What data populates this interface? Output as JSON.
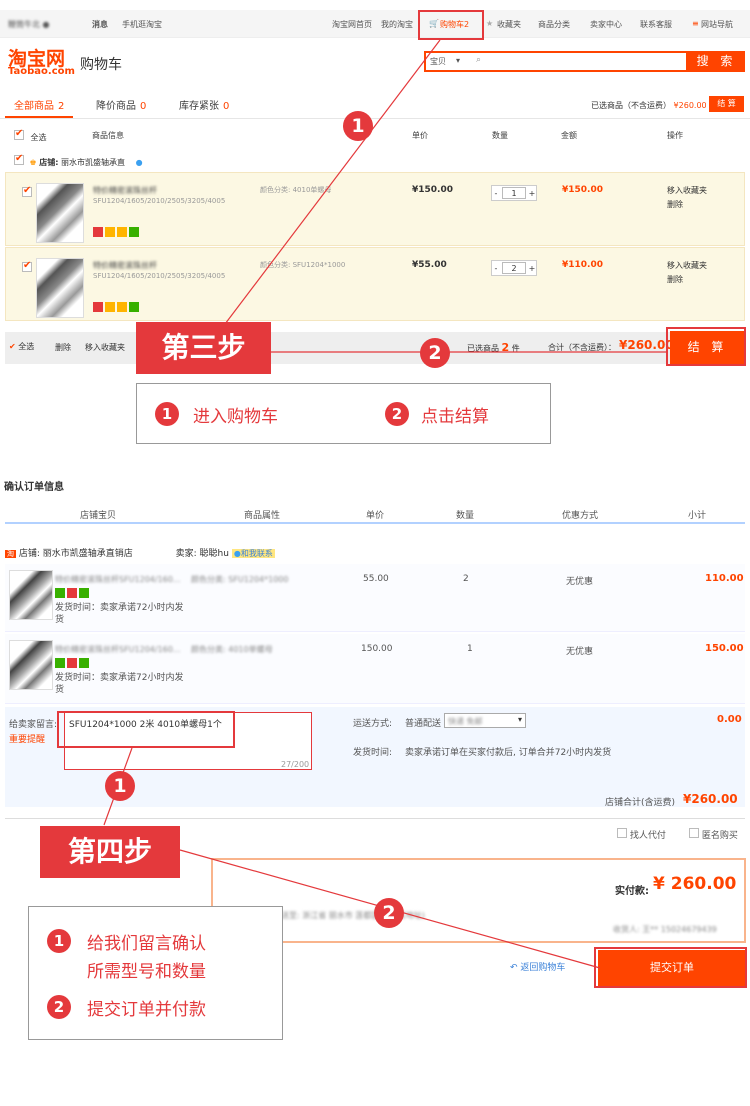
{
  "top_nav": {
    "user": "鞭筒牛北 ●",
    "messages": "消息",
    "mobile": "手机逛淘宝",
    "home": "淘宝网首页",
    "my_taobao": "我的淘宝",
    "cart": "购物车2",
    "favorites": "收藏夹",
    "categories": "商品分类",
    "seller_center": "卖家中心",
    "contact": "联系客服",
    "site_nav": "网站导航"
  },
  "header": {
    "logo_cn": "淘宝网",
    "logo_en": "Taobao.com",
    "page_title": "购物车",
    "search_scope": "宝贝",
    "search_button": "搜 索"
  },
  "cart_tabs": [
    {
      "label": "全部商品",
      "count": "2"
    },
    {
      "label": "降价商品",
      "count": "0"
    },
    {
      "label": "库存紧张",
      "count": "0"
    }
  ],
  "cart_summary": {
    "selected_label": "已选商品（不含运费）",
    "selected_amount": "¥260.00",
    "checkout_small": "结 算"
  },
  "cart_headers": {
    "select_all": "全选",
    "product_info": "商品信息",
    "unit_price": "单价",
    "quantity": "数量",
    "amount": "金额",
    "actions": "操作"
  },
  "shop": {
    "label": "店铺:",
    "name": "丽水市凯盛轴承直"
  },
  "cart_items": [
    {
      "title": "特价精密滚珠丝杆",
      "spec": "SFU1204/1605/2010/2505/3205/4005",
      "attr": "颜色分类: 4010单螺母",
      "price": "¥150.00",
      "qty": "1",
      "subtotal": "¥150.00",
      "move_fav": "移入收藏夹",
      "delete": "删除"
    },
    {
      "title": "特价精密滚珠丝杆",
      "spec": "SFU1204/1605/2010/2505/3205/4005",
      "attr": "颜色分类: SFU1204*1000",
      "price": "¥55.00",
      "qty": "2",
      "subtotal": "¥110.00",
      "move_fav": "移入收藏夹",
      "delete": "删除"
    }
  ],
  "cart_bottom": {
    "select_all": "全选",
    "delete": "删除",
    "move_fav": "移入收藏夹",
    "selected_prefix": "已选商品",
    "selected_count": "2",
    "selected_suffix": "件",
    "total_label": "合计（不含运费）：",
    "total_amount": "¥260.00",
    "checkout": "结 算"
  },
  "step3": {
    "banner": "第三步",
    "items": [
      {
        "num": "1",
        "text": "进入购物车"
      },
      {
        "num": "2",
        "text": "点击结算"
      }
    ],
    "marker1": "1",
    "marker2": "2"
  },
  "order": {
    "section_title": "确认订单信息",
    "headers": [
      "店铺宝贝",
      "商品属性",
      "单价",
      "数量",
      "优惠方式",
      "小计"
    ],
    "shop_label": "店铺: 丽水市凯盛轴承直销店",
    "seller_label": "卖家: 聪聪hu",
    "contact_label": "和我联系",
    "rows": [
      {
        "title": "特价精密滚珠丝杆SFU1204/160...",
        "attr": "颜色分类: SFU1204*1000",
        "price": "55.00",
        "qty": "2",
        "discount": "无优惠",
        "subtotal": "110.00",
        "ship_note": "发货时间：卖家承诺72小时内发货"
      },
      {
        "title": "特价精密滚珠丝杆SFU1204/160...",
        "attr": "颜色分类: 4010单螺母",
        "price": "150.00",
        "qty": "1",
        "discount": "无优惠",
        "subtotal": "150.00",
        "ship_note": "发货时间：卖家承诺72小时内发货"
      }
    ],
    "message_label": "给卖家留言:",
    "important_tip": "重要提醒",
    "message_value": "SFU1204*1000 2米   4010单螺母1个",
    "message_counter": "27/200",
    "shipping_label": "运送方式:",
    "shipping_method": "普通配送",
    "shipping_option": "快递 免邮",
    "shipping_cost": "0.00",
    "ship_time_label": "发货时间:",
    "ship_time_text": "卖家承诺订单在买家付款后, 订单合并72小时内发货",
    "shop_total_label": "店铺合计(含运费)",
    "shop_total": "¥260.00",
    "proxy_pay": "找人代付",
    "anonymous": "匿名购买",
    "pay_label": "实付款:",
    "pay_amount": "¥ 260.00",
    "address_text": "寄送至: 浙江省 丽水市 莲都区 ···· (某地址)",
    "receiver_text": "收货人: 王** 15024679439",
    "back_cart": "返回购物车",
    "submit": "提交订单"
  },
  "step4": {
    "banner": "第四步",
    "items": [
      {
        "num": "1",
        "text": "给我们留言确认"
      },
      {
        "num": "",
        "text": "所需型号和数量"
      },
      {
        "num": "2",
        "text": "提交订单并付款"
      }
    ],
    "marker1": "1",
    "marker2": "2"
  },
  "colors": {
    "accent": "#ff4400",
    "annotation": "#e4393c",
    "highlight_row": "#fcf8e3"
  }
}
